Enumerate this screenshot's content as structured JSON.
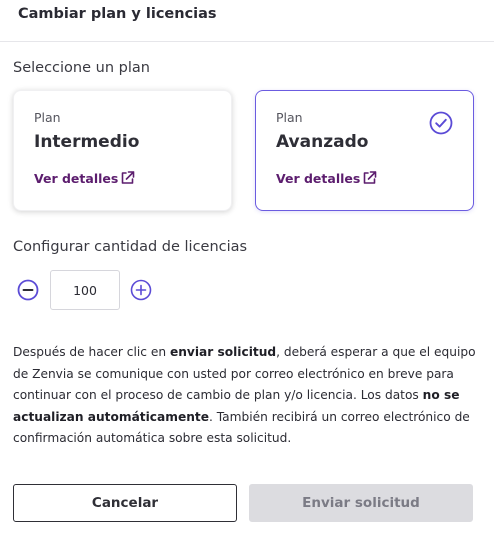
{
  "header": {
    "title": "Cambiar plan y licencias"
  },
  "plan_section": {
    "label": "Seleccione un plan",
    "plans": [
      {
        "kicker": "Plan",
        "name": "Intermedio",
        "details_label": "Ver detalles",
        "selected": false
      },
      {
        "kicker": "Plan",
        "name": "Avanzado",
        "details_label": "Ver detalles",
        "selected": true
      }
    ]
  },
  "licenses": {
    "label": "Configurar cantidad de licencias",
    "quantity": "100"
  },
  "info": {
    "part1": "Después de hacer clic en ",
    "bold1": "enviar solicitud",
    "part2": ", deberá esperar a que el equipo de Zenvia se comunique con usted por correo electrónico en breve para continuar con el proceso de cambio de plan y/o licencia. Los datos ",
    "bold2": "no se actualizan automáticamente",
    "part3": ". También recibirá un correo electrónico de confirmación automática sobre esta solicitud."
  },
  "actions": {
    "cancel_label": "Cancelar",
    "submit_label": "Enviar solicitud"
  },
  "colors": {
    "accent": "#5b4bd6",
    "link": "#5c1d6e",
    "disabled_bg": "#dcdce0",
    "disabled_text": "#7b7b85"
  },
  "icons": {
    "external": "external-link-icon",
    "check": "check-circle-icon",
    "minus": "minus-circle-icon",
    "plus": "plus-circle-icon"
  }
}
